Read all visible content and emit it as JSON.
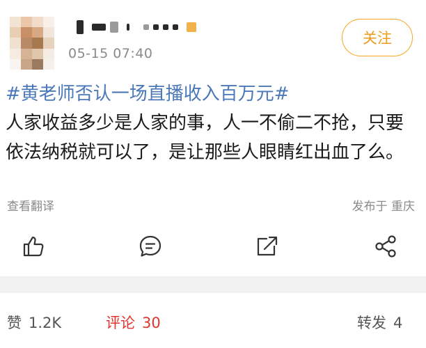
{
  "header": {
    "timestamp": "05-15 07:40",
    "follow_label": "关注"
  },
  "post": {
    "topic": "#黄老师否认一场直播收入百万元#",
    "text": "人家收益多少是人家的事，人一不偷二不抢，只要依法纳税就可以了，是让那些人眼睛红出血了么。",
    "translate_label": "查看翻译",
    "location_label": "发布于 重庆"
  },
  "actions": {
    "icons": [
      "thumbs-up-icon",
      "comment-icon",
      "repost-icon",
      "share-icon"
    ]
  },
  "stats": {
    "like_label": "赞",
    "like_count": "1.2K",
    "comment_label": "评论",
    "comment_count": "30",
    "repost_label": "转发",
    "repost_count": "4"
  },
  "colors": {
    "accent": "#f5a623",
    "topic": "#4a78b8",
    "active_tab": "#e0342f"
  }
}
